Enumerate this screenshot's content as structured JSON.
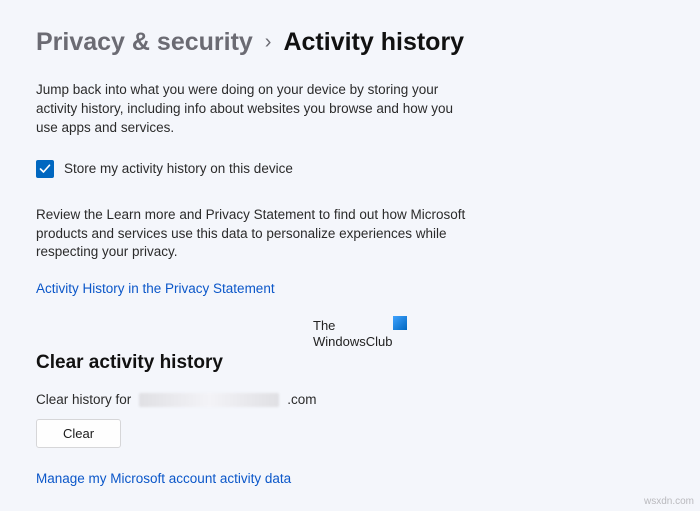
{
  "breadcrumb": {
    "parent": "Privacy & security",
    "current": "Activity history"
  },
  "intro": "Jump back into what you were doing on your device by storing your activity history, including info about websites you browse and how you use apps and services.",
  "checkbox": {
    "label": "Store my activity history on this device",
    "checked": true
  },
  "review": "Review the Learn more and Privacy Statement to find out how Microsoft products and services use this data to personalize experiences while respecting your privacy.",
  "links": {
    "privacy_statement": "Activity History in the Privacy Statement",
    "manage": "Manage my Microsoft account activity data"
  },
  "watermark": {
    "line1": "The",
    "line2": "WindowsClub"
  },
  "clear_section": {
    "heading": "Clear activity history",
    "prefix": "Clear history for",
    "suffix": ".com",
    "button": "Clear"
  },
  "footer_source": "wsxdn.com"
}
